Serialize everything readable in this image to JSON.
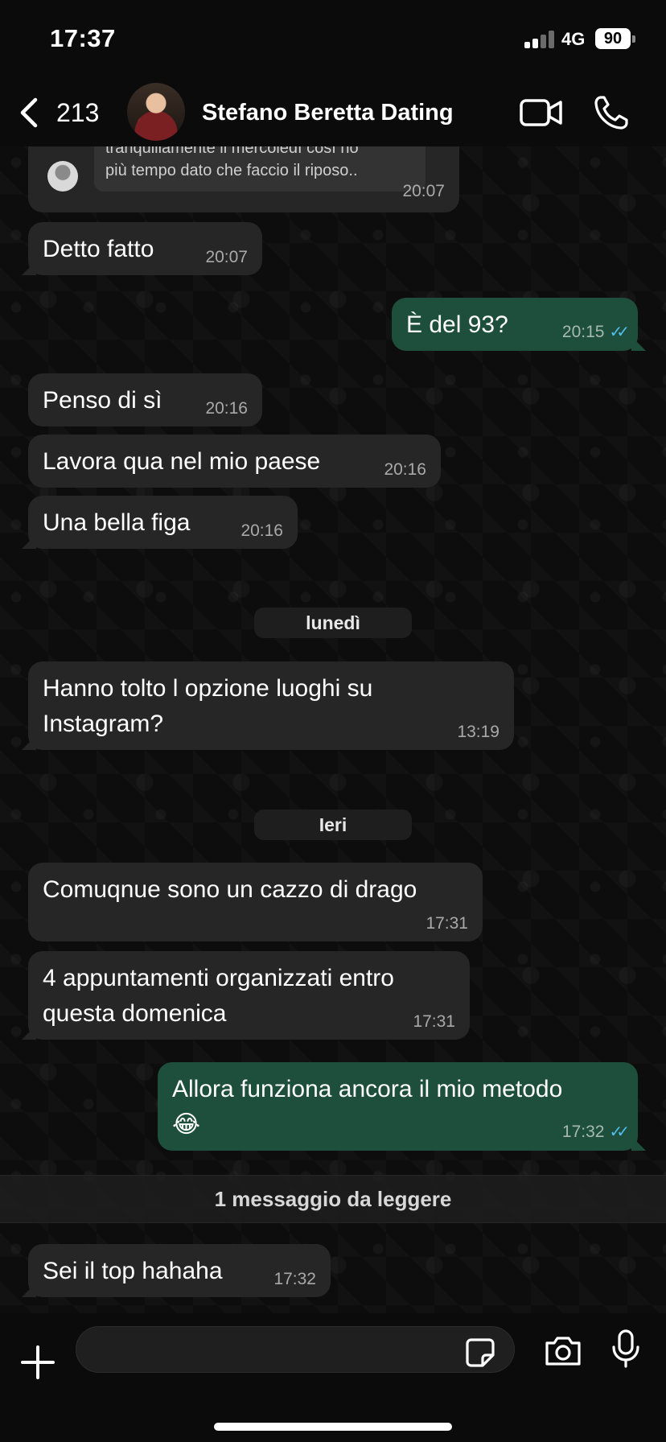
{
  "status_bar": {
    "time": "17:37",
    "network": "4G",
    "battery": "90"
  },
  "header": {
    "back_count": "213",
    "contact_name": "Stefano Beretta Dating"
  },
  "quoted_message": {
    "line1": "tranquillamente il mercoledì così ho",
    "line2": "più tempo dato che faccio il riposo..",
    "time": "20:07"
  },
  "messages": [
    {
      "dir": "in",
      "text": "Detto fatto",
      "time": "20:07"
    },
    {
      "dir": "out",
      "text": "È del 93?",
      "time": "20:15",
      "read": true
    },
    {
      "dir": "in",
      "text": "Penso di sì",
      "time": "20:16"
    },
    {
      "dir": "in",
      "text": "Lavora qua nel mio paese",
      "time": "20:16"
    },
    {
      "dir": "in",
      "text": "Una bella figa",
      "time": "20:16"
    },
    {
      "dir": "in",
      "text": "Hanno tolto l opzione luoghi su",
      "text2": "Instagram?",
      "time": "13:19"
    },
    {
      "dir": "in",
      "text": "Comuqnue sono un cazzo di drago",
      "time": "17:31"
    },
    {
      "dir": "in",
      "text": "4 appuntamenti organizzati entro",
      "text2": "questa domenica",
      "time": "17:31"
    },
    {
      "dir": "out",
      "text": "Allora funziona ancora il mio metodo",
      "text2": "😂",
      "time": "17:32",
      "read": true
    },
    {
      "dir": "in",
      "text": "Sei il top hahaha",
      "time": "17:32"
    }
  ],
  "date_separators": [
    "lunedì",
    "Ieri"
  ],
  "unread_banner": "1 messaggio da leggere",
  "colors": {
    "incoming": "#262626",
    "outgoing": "#1d4f3c",
    "read_ticks": "#53bdeb"
  }
}
